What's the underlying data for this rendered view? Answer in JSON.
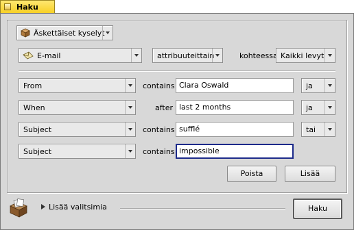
{
  "window": {
    "title": "Haku"
  },
  "recent": {
    "label": "Äskettäiset kyselyt"
  },
  "type_row": {
    "type_value": "E-mail",
    "mode_value": "attribuuteittain",
    "target_label": "kohteessa",
    "target_value": "Kaikki levyt"
  },
  "rows": [
    {
      "attribute": "From",
      "operator": "contains",
      "value": "Clara Oswald",
      "conjunction": "ja"
    },
    {
      "attribute": "When",
      "operator": "after",
      "value": "last 2 months",
      "conjunction": "ja"
    },
    {
      "attribute": "Subject",
      "operator": "contains",
      "value": "sufflé",
      "conjunction": "tai"
    },
    {
      "attribute": "Subject",
      "operator": "contains",
      "value": "impossible"
    }
  ],
  "buttons": {
    "remove": "Poista",
    "add": "Lisää",
    "search": "Haku"
  },
  "more_options": {
    "label": "Lisää valitsimia"
  },
  "icons": {
    "tab_close": "close-box-icon",
    "recent": "package-icon",
    "type": "email-envelope-icon",
    "drive": "query-file-icon",
    "disclosure": "disclosure-triangle-icon"
  }
}
